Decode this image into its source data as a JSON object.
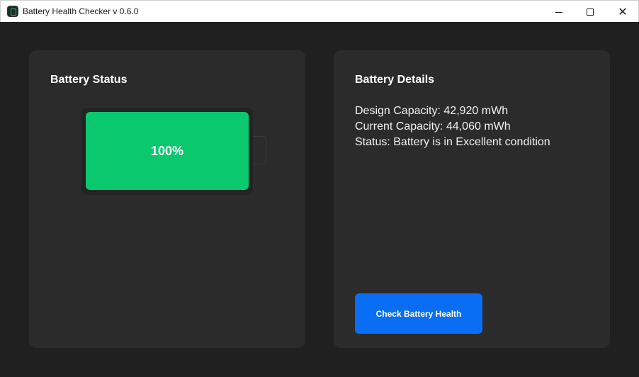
{
  "window": {
    "title": "Battery Health Checker v 0.6.0",
    "controls": {
      "minimize": "minimize",
      "maximize": "maximize",
      "close": "✕"
    }
  },
  "battery_status": {
    "title": "Battery Status",
    "percent_label": "100%",
    "charge_level": 1.0,
    "fill_color": "#09c86e"
  },
  "battery_details": {
    "title": "Battery Details",
    "lines": [
      "Design Capacity: 42,920 mWh",
      "Current Capacity: 44,060 mWh",
      "Status: Battery is in Excellent condition"
    ],
    "button_label": "Check Battery Health",
    "button_color": "#0a6ef5"
  },
  "colors": {
    "background": "#202020",
    "card": "#2b2b2b",
    "titlebar": "#ffffff"
  }
}
